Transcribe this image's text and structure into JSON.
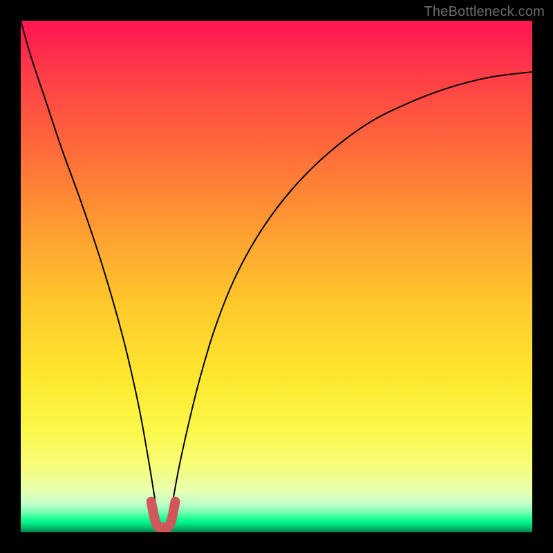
{
  "watermark": {
    "text": "TheBottleneck.com"
  },
  "chart_data": {
    "type": "line",
    "title": "",
    "xlabel": "",
    "ylabel": "",
    "xlim": [
      0,
      100
    ],
    "ylim": [
      0,
      100
    ],
    "grid": false,
    "legend": false,
    "series": [
      {
        "name": "bottleneck-curve",
        "x": [
          0,
          2,
          5,
          8,
          12,
          16,
          20,
          23,
          25,
          26.5,
          27.5,
          28.5,
          29.5,
          31,
          33,
          35,
          38,
          42,
          47,
          53,
          60,
          68,
          76,
          84,
          92,
          100
        ],
        "values": [
          100,
          93,
          84,
          75,
          64,
          52,
          38,
          25,
          14,
          5,
          1,
          1,
          5,
          13,
          22,
          30,
          40,
          50,
          59,
          67,
          74,
          80,
          84,
          87,
          89,
          90
        ]
      },
      {
        "name": "optimal-band",
        "x": [
          25.5,
          26.2,
          27.0,
          28.0,
          28.8,
          29.5,
          30.2
        ],
        "values": [
          6.0,
          2.5,
          1.0,
          1.0,
          1.0,
          2.5,
          6.0
        ]
      }
    ],
    "colors": {
      "curve": "#000000",
      "band": "#d1575c",
      "gradient_top": "#ff1b52",
      "gradient_bottom": "#008a50"
    }
  }
}
